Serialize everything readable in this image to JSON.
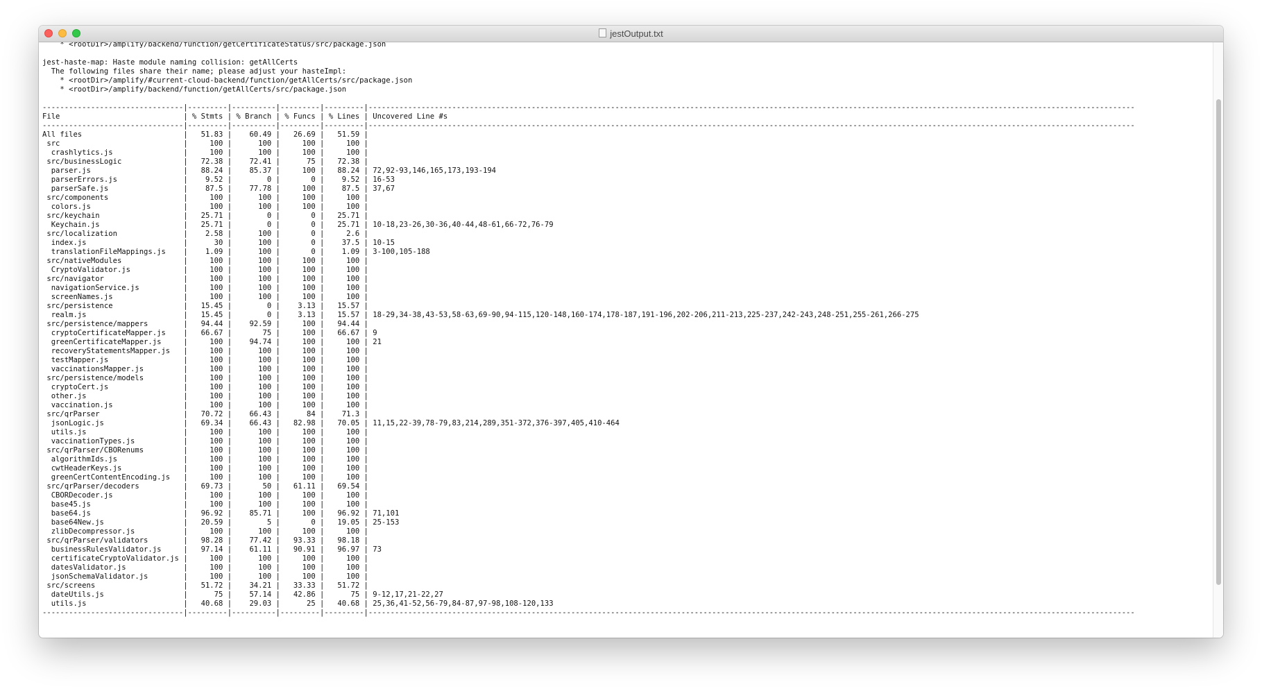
{
  "window": {
    "title": "jestOutput.txt"
  },
  "log_lines": [
    "    * <rootDir>/amplify/backend/function/getCertificateStatus/src/package.json",
    "",
    "jest-haste-map: Haste module naming collision: getAllCerts",
    "  The following files share their name; please adjust your hasteImpl:",
    "    * <rootDir>/amplify/#current-cloud-backend/function/getAllCerts/src/package.json",
    "    * <rootDir>/amplify/backend/function/getAllCerts/src/package.json",
    ""
  ],
  "coverage": {
    "separator": "--------------------------------|---------|----------|---------|---------|------------------------------------------------------------------------------------------------------------------------------------------------------------------------------",
    "columns": [
      "File",
      "% Stmts",
      "% Branch",
      "% Funcs",
      "% Lines",
      "Uncovered Line #s"
    ],
    "rows": [
      [
        "All files",
        "51.83",
        "60.49",
        "26.69",
        "51.59",
        ""
      ],
      [
        " src",
        "100",
        "100",
        "100",
        "100",
        ""
      ],
      [
        "  crashlytics.js",
        "100",
        "100",
        "100",
        "100",
        ""
      ],
      [
        " src/businessLogic",
        "72.38",
        "72.41",
        "75",
        "72.38",
        ""
      ],
      [
        "  parser.js",
        "88.24",
        "85.37",
        "100",
        "88.24",
        "72,92-93,146,165,173,193-194"
      ],
      [
        "  parserErrors.js",
        "9.52",
        "0",
        "0",
        "9.52",
        "16-53"
      ],
      [
        "  parserSafe.js",
        "87.5",
        "77.78",
        "100",
        "87.5",
        "37,67"
      ],
      [
        " src/components",
        "100",
        "100",
        "100",
        "100",
        ""
      ],
      [
        "  colors.js",
        "100",
        "100",
        "100",
        "100",
        ""
      ],
      [
        " src/keychain",
        "25.71",
        "0",
        "0",
        "25.71",
        ""
      ],
      [
        "  Keychain.js",
        "25.71",
        "0",
        "0",
        "25.71",
        "10-18,23-26,30-36,40-44,48-61,66-72,76-79"
      ],
      [
        " src/localization",
        "2.58",
        "100",
        "0",
        "2.6",
        ""
      ],
      [
        "  index.js",
        "30",
        "100",
        "0",
        "37.5",
        "10-15"
      ],
      [
        "  translationFileMappings.js",
        "1.09",
        "100",
        "0",
        "1.09",
        "3-100,105-188"
      ],
      [
        " src/nativeModules",
        "100",
        "100",
        "100",
        "100",
        ""
      ],
      [
        "  CryptoValidator.js",
        "100",
        "100",
        "100",
        "100",
        ""
      ],
      [
        " src/navigator",
        "100",
        "100",
        "100",
        "100",
        ""
      ],
      [
        "  navigationService.js",
        "100",
        "100",
        "100",
        "100",
        ""
      ],
      [
        "  screenNames.js",
        "100",
        "100",
        "100",
        "100",
        ""
      ],
      [
        " src/persistence",
        "15.45",
        "0",
        "3.13",
        "15.57",
        ""
      ],
      [
        "  realm.js",
        "15.45",
        "0",
        "3.13",
        "15.57",
        "18-29,34-38,43-53,58-63,69-90,94-115,120-148,160-174,178-187,191-196,202-206,211-213,225-237,242-243,248-251,255-261,266-275"
      ],
      [
        " src/persistence/mappers",
        "94.44",
        "92.59",
        "100",
        "94.44",
        ""
      ],
      [
        "  cryptoCertificateMapper.js",
        "66.67",
        "75",
        "100",
        "66.67",
        "9"
      ],
      [
        "  greenCertificateMapper.js",
        "100",
        "94.74",
        "100",
        "100",
        "21"
      ],
      [
        "  recoveryStatementsMapper.js",
        "100",
        "100",
        "100",
        "100",
        ""
      ],
      [
        "  testMapper.js",
        "100",
        "100",
        "100",
        "100",
        ""
      ],
      [
        "  vaccinationsMapper.js",
        "100",
        "100",
        "100",
        "100",
        ""
      ],
      [
        " src/persistence/models",
        "100",
        "100",
        "100",
        "100",
        ""
      ],
      [
        "  cryptoCert.js",
        "100",
        "100",
        "100",
        "100",
        ""
      ],
      [
        "  other.js",
        "100",
        "100",
        "100",
        "100",
        ""
      ],
      [
        "  vaccination.js",
        "100",
        "100",
        "100",
        "100",
        ""
      ],
      [
        " src/qrParser",
        "70.72",
        "66.43",
        "84",
        "71.3",
        ""
      ],
      [
        "  jsonLogic.js",
        "69.34",
        "66.43",
        "82.98",
        "70.05",
        "11,15,22-39,78-79,83,214,289,351-372,376-397,405,410-464"
      ],
      [
        "  utils.js",
        "100",
        "100",
        "100",
        "100",
        ""
      ],
      [
        "  vaccinationTypes.js",
        "100",
        "100",
        "100",
        "100",
        ""
      ],
      [
        " src/qrParser/CBORenums",
        "100",
        "100",
        "100",
        "100",
        ""
      ],
      [
        "  algorithmIds.js",
        "100",
        "100",
        "100",
        "100",
        ""
      ],
      [
        "  cwtHeaderKeys.js",
        "100",
        "100",
        "100",
        "100",
        ""
      ],
      [
        "  greenCertContentEncoding.js",
        "100",
        "100",
        "100",
        "100",
        ""
      ],
      [
        " src/qrParser/decoders",
        "69.73",
        "50",
        "61.11",
        "69.54",
        ""
      ],
      [
        "  CBORDecoder.js",
        "100",
        "100",
        "100",
        "100",
        ""
      ],
      [
        "  base45.js",
        "100",
        "100",
        "100",
        "100",
        ""
      ],
      [
        "  base64.js",
        "96.92",
        "85.71",
        "100",
        "96.92",
        "71,101"
      ],
      [
        "  base64New.js",
        "20.59",
        "5",
        "0",
        "19.05",
        "25-153"
      ],
      [
        "  zlibDecompressor.js",
        "100",
        "100",
        "100",
        "100",
        ""
      ],
      [
        " src/qrParser/validators",
        "98.28",
        "77.42",
        "93.33",
        "98.18",
        ""
      ],
      [
        "  businessRulesValidator.js",
        "97.14",
        "61.11",
        "90.91",
        "96.97",
        "73"
      ],
      [
        "  certificateCryptoValidator.js",
        "100",
        "100",
        "100",
        "100",
        ""
      ],
      [
        "  datesValidator.js",
        "100",
        "100",
        "100",
        "100",
        ""
      ],
      [
        "  jsonSchemaValidator.js",
        "100",
        "100",
        "100",
        "100",
        ""
      ],
      [
        " src/screens",
        "51.72",
        "34.21",
        "33.33",
        "51.72",
        ""
      ],
      [
        "  dateUtils.js",
        "75",
        "57.14",
        "42.86",
        "75",
        "9-12,17,21-22,27"
      ],
      [
        "  utils.js",
        "40.68",
        "29.03",
        "25",
        "40.68",
        "25,36,41-52,56-79,84-87,97-98,108-120,133"
      ]
    ]
  }
}
